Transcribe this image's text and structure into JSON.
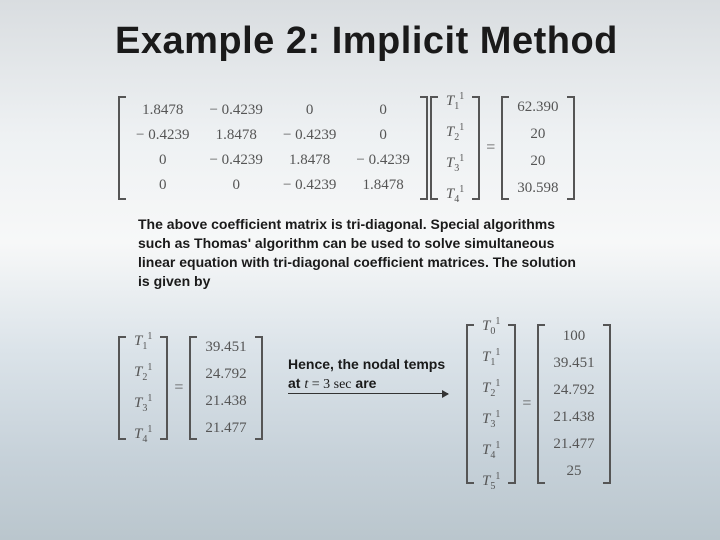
{
  "title": "Example 2: Implicit Method",
  "matrixA": [
    [
      "1.8478",
      "− 0.4239",
      "0",
      "0"
    ],
    [
      "− 0.4239",
      "1.8478",
      "− 0.4239",
      "0"
    ],
    [
      "0",
      "− 0.4239",
      "1.8478",
      "− 0.4239"
    ],
    [
      "0",
      "0",
      "− 0.4239",
      "1.8478"
    ]
  ],
  "vecT": [
    {
      "name": "T",
      "sub": "1",
      "sup": "1"
    },
    {
      "name": "T",
      "sub": "2",
      "sup": "1"
    },
    {
      "name": "T",
      "sub": "3",
      "sup": "1"
    },
    {
      "name": "T",
      "sub": "4",
      "sup": "1"
    }
  ],
  "rhs1": [
    "62.390",
    "20",
    "20",
    "30.598"
  ],
  "paragraph": "The above coefficient matrix is tri-diagonal. Special algorithms such as Thomas' algorithm can be used to solve simultaneous linear equation with tri-diagonal coefficient matrices. The solution is given by",
  "solT": [
    {
      "name": "T",
      "sub": "1",
      "sup": "1"
    },
    {
      "name": "T",
      "sub": "2",
      "sup": "1"
    },
    {
      "name": "T",
      "sub": "3",
      "sup": "1"
    },
    {
      "name": "T",
      "sub": "4",
      "sup": "1"
    }
  ],
  "solVals": [
    "39.451",
    "24.792",
    "21.438",
    "21.477"
  ],
  "nodal_prefix": "Hence, the nodal temps at ",
  "nodal_t": "t = 3 sec",
  "nodal_suffix": " are",
  "fullT": [
    {
      "name": "T",
      "sub": "0",
      "sup": "1"
    },
    {
      "name": "T",
      "sub": "1",
      "sup": "1"
    },
    {
      "name": "T",
      "sub": "2",
      "sup": "1"
    },
    {
      "name": "T",
      "sub": "3",
      "sup": "1"
    },
    {
      "name": "T",
      "sub": "4",
      "sup": "1"
    },
    {
      "name": "T",
      "sub": "5",
      "sup": "1"
    }
  ],
  "fullVals": [
    "100",
    "39.451",
    "24.792",
    "21.438",
    "21.477",
    "25"
  ]
}
